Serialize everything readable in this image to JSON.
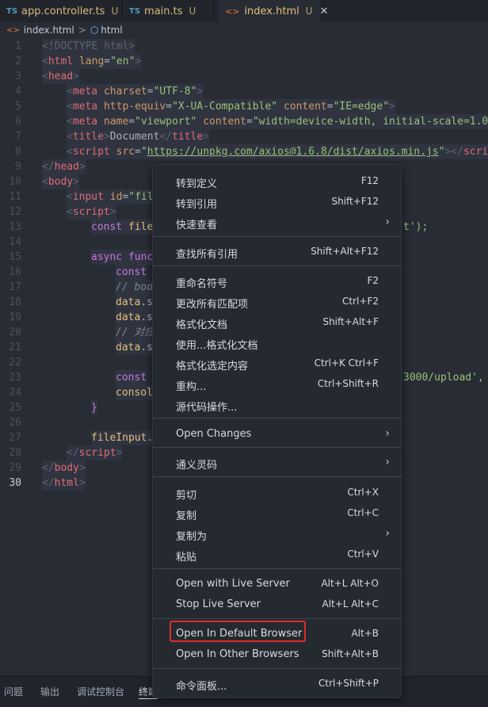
{
  "tabs": [
    {
      "icon": "TS",
      "name": "app.controller.ts",
      "status": "U"
    },
    {
      "icon": "TS",
      "name": "main.ts",
      "status": "U"
    },
    {
      "icon": "<>",
      "name": "index.html",
      "status": "U",
      "close": "✕"
    }
  ],
  "breadcrumb": {
    "file": "index.html",
    "sep": ">",
    "symbol": "html"
  },
  "editor": {
    "line_numbers": [
      "1",
      "2",
      "3",
      "4",
      "5",
      "6",
      "7",
      "8",
      "9",
      "10",
      "11",
      "12",
      "13",
      "14",
      "15",
      "16",
      "17",
      "18",
      "19",
      "20",
      "21",
      "22",
      "23",
      "24",
      "25",
      "26",
      "27",
      "28",
      "29",
      "30"
    ],
    "code": {
      "l1": [
        "<!DOCTYPE html>"
      ],
      "l2": [
        "<",
        "html",
        " lang",
        "=",
        "\"en\"",
        ">"
      ],
      "l3": [
        "<",
        "head",
        ">"
      ],
      "l4": [
        "<",
        "meta",
        " charset",
        "=",
        "\"UTF-8\"",
        ">"
      ],
      "l5": [
        "<",
        "meta",
        " http-equiv",
        "=",
        "\"X-UA-Compatible\"",
        " content",
        "=",
        "\"IE=edge\"",
        ">"
      ],
      "l6": [
        "<",
        "meta",
        " name",
        "=",
        "\"viewport\"",
        " content",
        "=",
        "\"width=device-width, initial-scale=1.0\"",
        ">"
      ],
      "l7": [
        "<",
        "title",
        ">",
        "Document",
        "</",
        "title",
        ">"
      ],
      "l8": [
        "<",
        "script",
        " src",
        "=",
        "\"",
        "https://unpkg.com/axios@1.6.8/dist/axios.min.js",
        "\"",
        "></",
        "script",
        ">"
      ],
      "l9": [
        "</",
        "head",
        ">"
      ],
      "l10": [
        "<",
        "body",
        ">"
      ],
      "l11": [
        "<",
        "input",
        " id",
        "=",
        "\"fil"
      ],
      "l12": [
        "<",
        "script",
        ">"
      ],
      "l13": [
        "const",
        " file",
        "t');"
      ],
      "l15": [
        "async",
        " func"
      ],
      "l16": [
        "const"
      ],
      "l17": [
        "// bod"
      ],
      "l18": [
        "data",
        ".s"
      ],
      "l19": [
        "data",
        ".s"
      ],
      "l20": [
        "// 对应"
      ],
      "l21": [
        "data",
        ".s"
      ],
      "l23": [
        "const",
        "3000/upload",
        "',"
      ],
      "l24": [
        "consol"
      ],
      "l25": [
        "}"
      ],
      "l27": [
        "fileInput",
        "."
      ],
      "l28": [
        "</",
        "script",
        ">"
      ],
      "l29": [
        "</",
        "body",
        ">"
      ],
      "l30": [
        "</",
        "html",
        ">"
      ]
    }
  },
  "context_menu": {
    "items": [
      {
        "label": "转到定义",
        "shortcut": "F12"
      },
      {
        "label": "转到引用",
        "shortcut": "Shift+F12"
      },
      {
        "label": "快速查看",
        "submenu": "›"
      },
      {
        "label": "查找所有引用",
        "shortcut": "Shift+Alt+F12"
      },
      {
        "label": "重命名符号",
        "shortcut": "F2"
      },
      {
        "label": "更改所有匹配项",
        "shortcut": "Ctrl+F2"
      },
      {
        "label": "格式化文档",
        "shortcut": "Shift+Alt+F"
      },
      {
        "label": "使用...格式化文档",
        "shortcut": ""
      },
      {
        "label": "格式化选定内容",
        "shortcut": "Ctrl+K Ctrl+F"
      },
      {
        "label": "重构...",
        "shortcut": "Ctrl+Shift+R"
      },
      {
        "label": "源代码操作...",
        "shortcut": ""
      },
      {
        "label": "Open Changes",
        "submenu": "›"
      },
      {
        "label": "通义灵码",
        "submenu": "›"
      },
      {
        "label": "剪切",
        "shortcut": "Ctrl+X"
      },
      {
        "label": "复制",
        "shortcut": "Ctrl+C"
      },
      {
        "label": "复制为",
        "submenu": "›"
      },
      {
        "label": "粘贴",
        "shortcut": "Ctrl+V"
      },
      {
        "label": "Open with Live Server",
        "shortcut": "Alt+L Alt+O"
      },
      {
        "label": "Stop Live Server",
        "shortcut": "Alt+L Alt+C"
      },
      {
        "label": "Open In Default Browser",
        "shortcut": "Alt+B"
      },
      {
        "label": "Open In Other Browsers",
        "shortcut": "Shift+Alt+B"
      },
      {
        "label": "命令面板...",
        "shortcut": "Ctrl+Shift+P"
      }
    ]
  },
  "panel": {
    "tabs": [
      "问题",
      "输出",
      "调试控制台",
      "终端"
    ]
  },
  "colors": {
    "editor_bg": "#282c34",
    "menu_bg": "#252a31",
    "highlight_border": "#e02a2a"
  }
}
